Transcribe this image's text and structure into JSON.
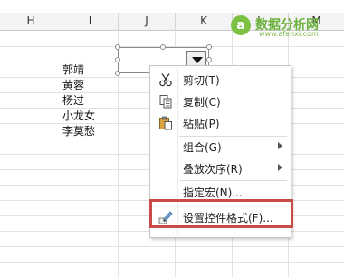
{
  "columns": [
    "H",
    "I",
    "J",
    "K",
    "L",
    "M"
  ],
  "cells": [
    "郭靖",
    "黄蓉",
    "杨过",
    "小龙女",
    "李莫愁"
  ],
  "combo_control": {
    "dropdown_arrow": "triangle-down-icon"
  },
  "context_menu": {
    "items": [
      {
        "label": "剪切(T)",
        "icon": "scissors-icon"
      },
      {
        "label": "复制(C)",
        "icon": "copy-icon"
      },
      {
        "label": "粘贴(P)",
        "icon": "paste-icon"
      },
      {
        "label": "组合(G)",
        "submenu": true
      },
      {
        "label": "叠放次序(R)",
        "submenu": true
      },
      {
        "label": "指定宏(N)..."
      },
      {
        "label": "设置控件格式(F)...",
        "icon": "format-control-icon",
        "highlighted": true
      }
    ]
  },
  "watermark": {
    "name": "数据分析网",
    "url": "www.afenxi.com",
    "logo_letter": "a"
  },
  "colors": {
    "highlight_border": "#c94a47",
    "watermark_green": "#6ab23c"
  }
}
